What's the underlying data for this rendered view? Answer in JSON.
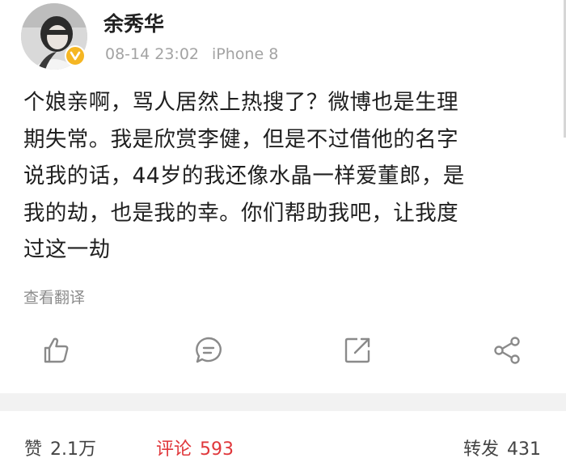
{
  "user": {
    "name": "余秀华",
    "timestamp": "08-14 23:02",
    "device": "iPhone 8",
    "verified_icon": "verified-badge-icon"
  },
  "post": {
    "lines": [
      "个娘亲啊，骂人居然上热搜了？微博也是生理",
      "期失常。我是欣赏李健，但是不过借他的名字",
      "说我的话，44岁的我还像水晶一样爱董郎，是",
      "我的劫，也是我的幸。你们帮助我吧，让我度",
      "过这一劫"
    ],
    "translate_label": "查看翻译"
  },
  "actions": {
    "like_icon": "thumbs-up-icon",
    "comment_icon": "comment-bubble-icon",
    "forward_icon": "external-forward-icon",
    "share_icon": "share-nodes-icon"
  },
  "stats": {
    "likes_label": "赞",
    "likes_count": "2.1万",
    "comments_label": "评论",
    "comments_count": "593",
    "reposts_label": "转发",
    "reposts_count": "431"
  },
  "colors": {
    "accent_red": "#e0373b",
    "verified_gold": "#f5b623",
    "meta_gray": "#a3a3a3"
  }
}
